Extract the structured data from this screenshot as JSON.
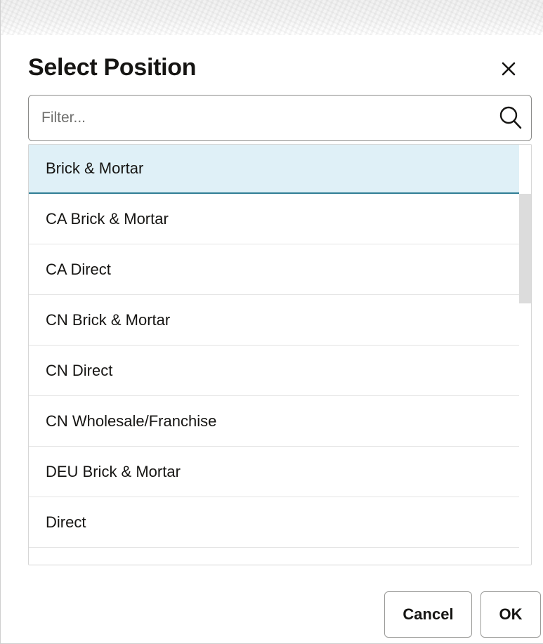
{
  "dialog": {
    "title": "Select Position",
    "close_icon": "close-icon"
  },
  "filter": {
    "value": "",
    "placeholder": "Filter...",
    "icon": "search-icon"
  },
  "positions": {
    "items": [
      {
        "label": "Brick & Mortar",
        "selected": true
      },
      {
        "label": "CA Brick & Mortar",
        "selected": false
      },
      {
        "label": "CA Direct",
        "selected": false
      },
      {
        "label": "CN Brick & Mortar",
        "selected": false
      },
      {
        "label": "CN Direct",
        "selected": false
      },
      {
        "label": "CN Wholesale/Franchise",
        "selected": false
      },
      {
        "label": "DEU Brick & Mortar",
        "selected": false
      },
      {
        "label": "Direct",
        "selected": false
      },
      {
        "label": "",
        "selected": false
      }
    ]
  },
  "footer": {
    "cancel_label": "Cancel",
    "ok_label": "OK"
  },
  "colors": {
    "selected_row_background": "#dff0f7",
    "selected_row_border": "#2f7d94",
    "text": "#161513"
  }
}
